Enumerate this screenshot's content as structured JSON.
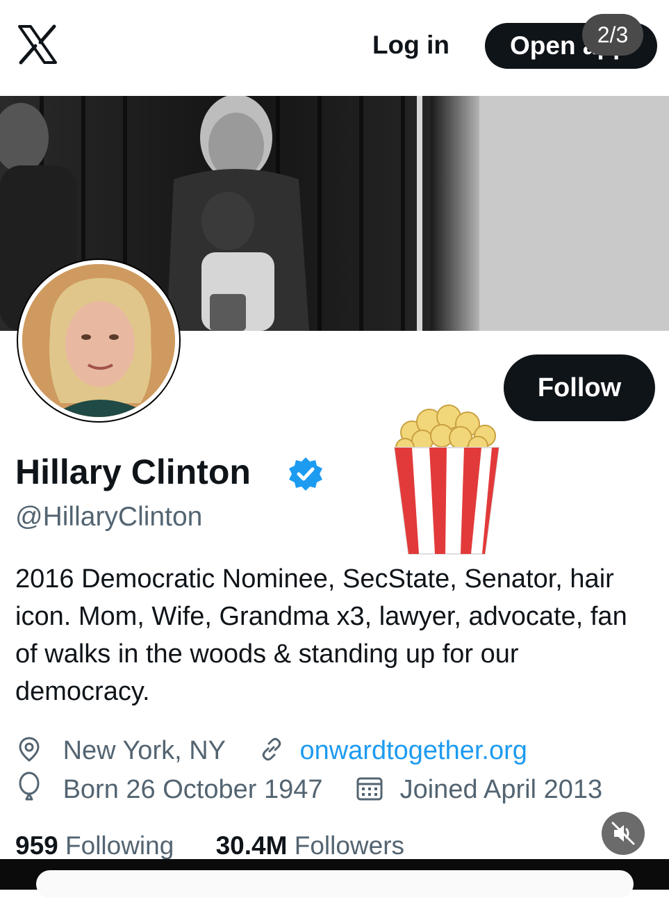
{
  "pager": "2/3",
  "header": {
    "login_label": "Log in",
    "open_app_label": "Open app"
  },
  "profile": {
    "name": "Hillary Clinton",
    "handle": "@HillaryClinton",
    "follow_label": "Follow",
    "bio": "2016 Democratic Nominee, SecState, Senator, hair icon. Mom, Wife, Grandma x3, lawyer, advocate, fan of walks in the woods & standing up for our democracy.",
    "location": "New York, NY",
    "website": "onwardtogether.org",
    "born": "Born 26 October 1947",
    "joined": "Joined April 2013",
    "following_count": "959",
    "following_label": "Following",
    "followers_count": "30.4M",
    "followers_label": "Followers"
  },
  "icons": [
    "x-logo-icon",
    "verified-badge-icon",
    "popcorn-icon",
    "location-pin-icon",
    "link-icon",
    "balloon-icon",
    "calendar-icon",
    "mute-icon"
  ],
  "colors": {
    "accent": "#1d9bf0",
    "text": "#0f1419",
    "muted": "#536471",
    "button": "#0f1419"
  }
}
